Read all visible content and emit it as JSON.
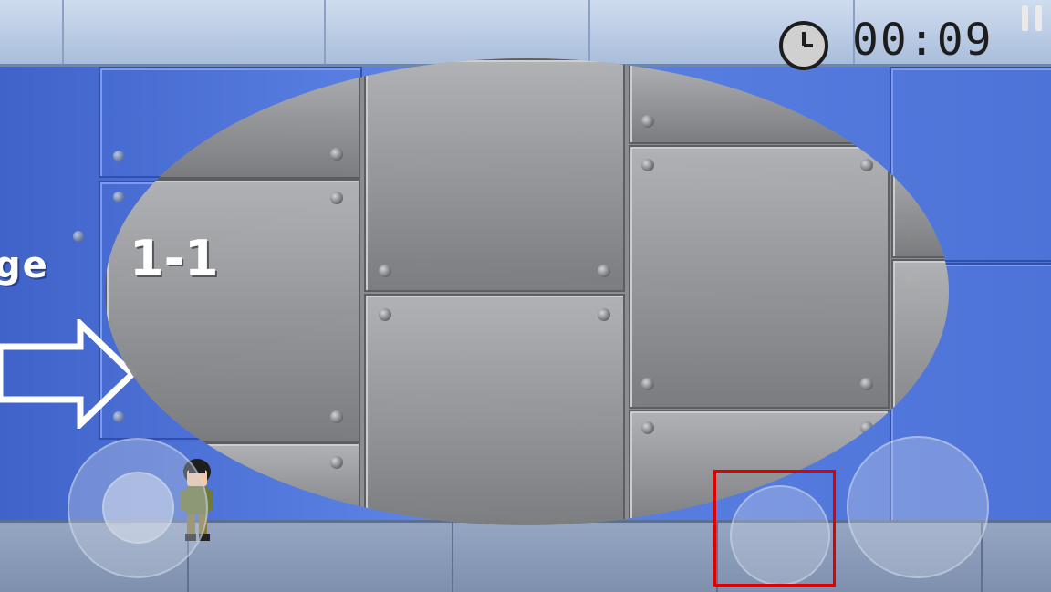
{
  "hud": {
    "timer": "00:09",
    "clock_icon": "clock-icon",
    "pause_icon": "pause-icon"
  },
  "stage": {
    "label_fragment": "ge",
    "number": "1-1"
  },
  "controls": {
    "joystick": "virtual-joystick",
    "action_a": "action-button",
    "action_b": "action-button",
    "highlight_color": "#e00000"
  },
  "colors": {
    "wall": "#4d73d8",
    "oval": "#8e8e8e",
    "floor": "#8a9bb8"
  }
}
